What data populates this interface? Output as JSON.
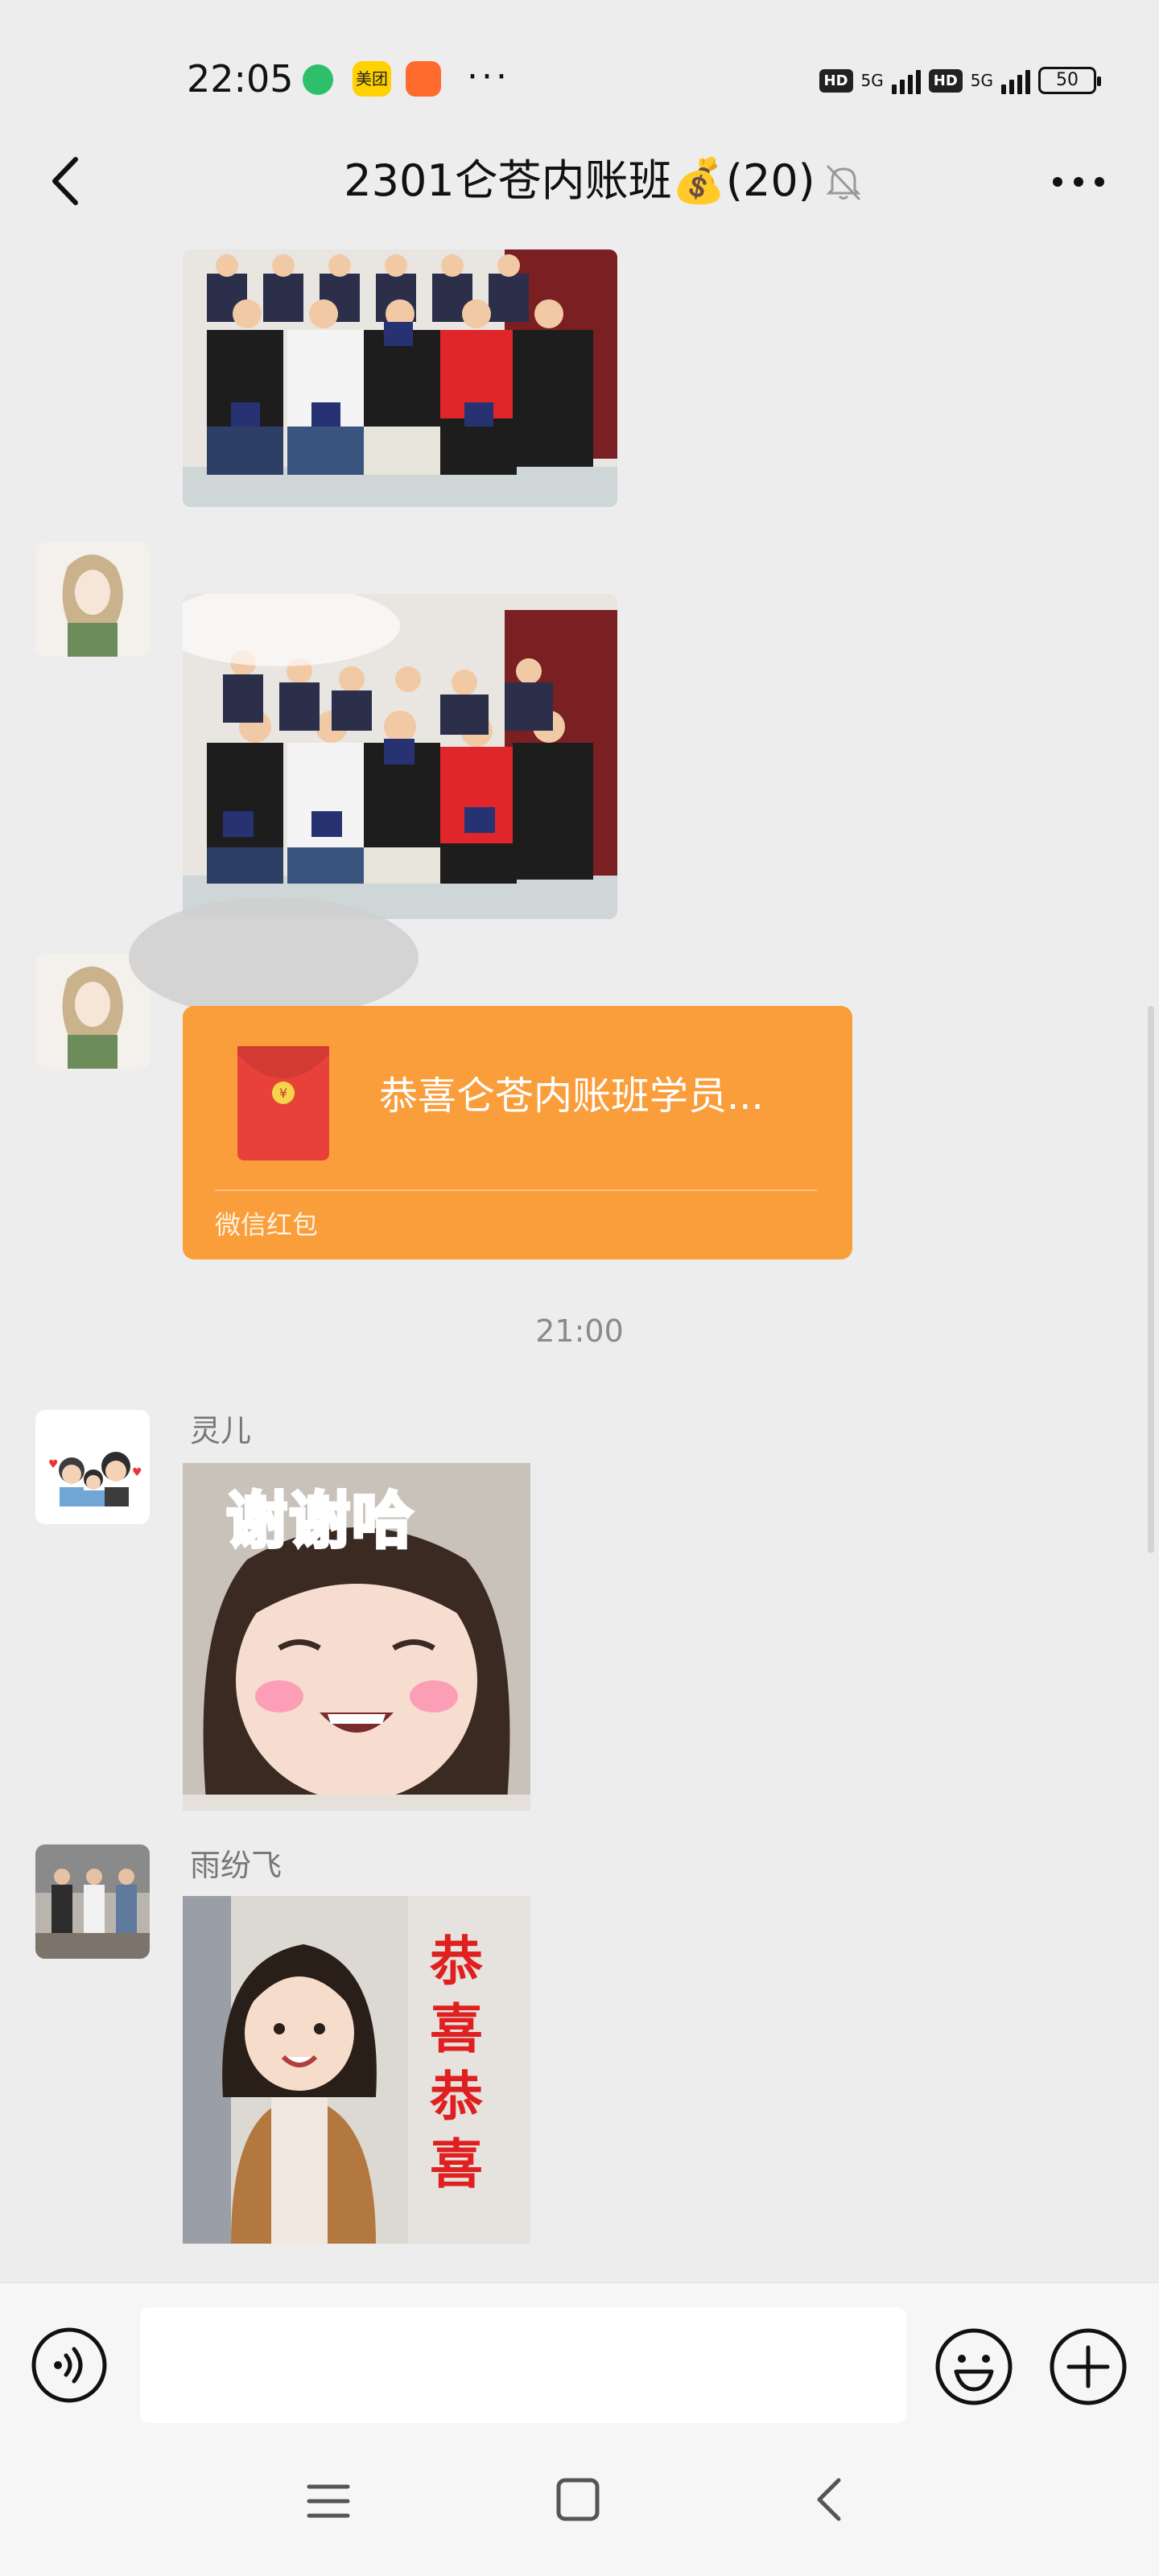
{
  "status_bar": {
    "time": "22:05",
    "app_badge": "美团",
    "more": "···",
    "hd1": "HD",
    "net1": "5G",
    "hd2": "HD",
    "net2": "5G",
    "battery": "50"
  },
  "header": {
    "title": "2301仑苍内账班💰(20)",
    "back_icon": "back-chevron-icon",
    "mute_icon": "bell-muted-icon",
    "more_icon": "more-dots-icon"
  },
  "messages": {
    "red_packet": {
      "title": "恭喜仑苍内账班学员...",
      "caption": "微信红包",
      "color": "#fa9d3b"
    },
    "timestamp": "21:00",
    "sticker1": {
      "sender": "灵儿",
      "caption": "谢谢哈"
    },
    "sticker2": {
      "sender": "雨纷飞",
      "caption_lines": [
        "恭",
        "喜",
        "恭",
        "喜"
      ]
    }
  },
  "input_bar": {
    "voice_icon": "voice-icon",
    "emoji_icon": "emoji-icon",
    "plus_icon": "plus-icon"
  },
  "nav_bar": {
    "menu_icon": "menu-icon",
    "home_icon": "home-icon",
    "back_icon": "back-icon"
  }
}
